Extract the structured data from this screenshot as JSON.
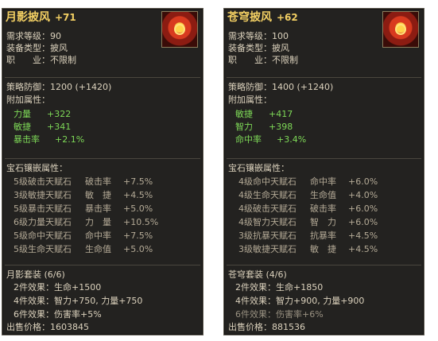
{
  "cards": [
    {
      "title": "月影披风",
      "plus": "+71",
      "level_label": "需求等级：",
      "level": "90",
      "type_label": "装备类型：",
      "type": "披风",
      "job_label": "职　　业：",
      "job": "不限制",
      "defense_label": "策略防御：",
      "defense": "1200 (+1420)",
      "attrs_label": "附加属性：",
      "attrs": [
        {
          "name": "力量",
          "value": "+322"
        },
        {
          "name": "敏捷",
          "value": "+341"
        },
        {
          "name": "暴击率",
          "value": "+2.1%"
        }
      ],
      "gems_label": "宝石镶嵌属性：",
      "gems": [
        {
          "name": "5级破击天赋石",
          "stat": "破击率",
          "value": "+7.5%"
        },
        {
          "name": "3级敏捷天赋石",
          "stat": "敏　捷",
          "value": "+4.5%"
        },
        {
          "name": "5级暴击天赋石",
          "stat": "暴击率",
          "value": "+5.0%"
        },
        {
          "name": "6级力量天赋石",
          "stat": "力　量",
          "value": "+10.5%"
        },
        {
          "name": "5级命中天赋石",
          "stat": "命中率",
          "value": "+7.5%"
        },
        {
          "name": "5级生命天赋石",
          "stat": "生命值",
          "value": "+5.0%"
        }
      ],
      "set_title": "月影套装 (6/6)",
      "set_effects": [
        {
          "label": "2件效果：",
          "value": "生命+1500"
        },
        {
          "label": "4件效果：",
          "value": "智力+750, 力量+750"
        },
        {
          "label": "6件效果：",
          "value": "伤害率+5%"
        }
      ],
      "price_label": "出售价格：",
      "price": "1603845"
    },
    {
      "title": "苍穹披风",
      "plus": "+62",
      "level_label": "需求等级：",
      "level": "100",
      "type_label": "装备类型：",
      "type": "披风",
      "job_label": "职　　业：",
      "job": "不限制",
      "defense_label": "策略防御：",
      "defense": "1400 (+1240)",
      "attrs_label": "附加属性：",
      "attrs": [
        {
          "name": "敏捷",
          "value": "+417"
        },
        {
          "name": "智力",
          "value": "+398"
        },
        {
          "name": "命中率",
          "value": "+3.4%"
        }
      ],
      "gems_label": "宝石镶嵌属性：",
      "gems": [
        {
          "name": "4级命中天赋石",
          "stat": "命中率",
          "value": "+6.0%"
        },
        {
          "name": "4级生命天赋石",
          "stat": "生命值",
          "value": "+4.0%"
        },
        {
          "name": "4级破击天赋石",
          "stat": "破击率",
          "value": "+6.0%"
        },
        {
          "name": "4级智力天赋石",
          "stat": "智　力",
          "value": "+6.0%"
        },
        {
          "name": "3级抗暴天赋石",
          "stat": "抗暴率",
          "value": "+4.5%"
        },
        {
          "name": "3级敏捷天赋石",
          "stat": "敏　捷",
          "value": "+4.5%"
        }
      ],
      "set_title": "苍穹套装 (4/6)",
      "set_effects": [
        {
          "label": "2件效果：",
          "value": "生命+1850"
        },
        {
          "label": "4件效果：",
          "value": "智力+900, 力量+900"
        },
        {
          "label": "6件效果：",
          "value": "伤害率+6%"
        }
      ],
      "price_label": "出售价格：",
      "price": "881536"
    }
  ],
  "colors": {
    "background": "#232220",
    "title": "#f2cf63",
    "green": "#7ed957",
    "text": "#dcd2bd",
    "dim": "#9a9282"
  }
}
